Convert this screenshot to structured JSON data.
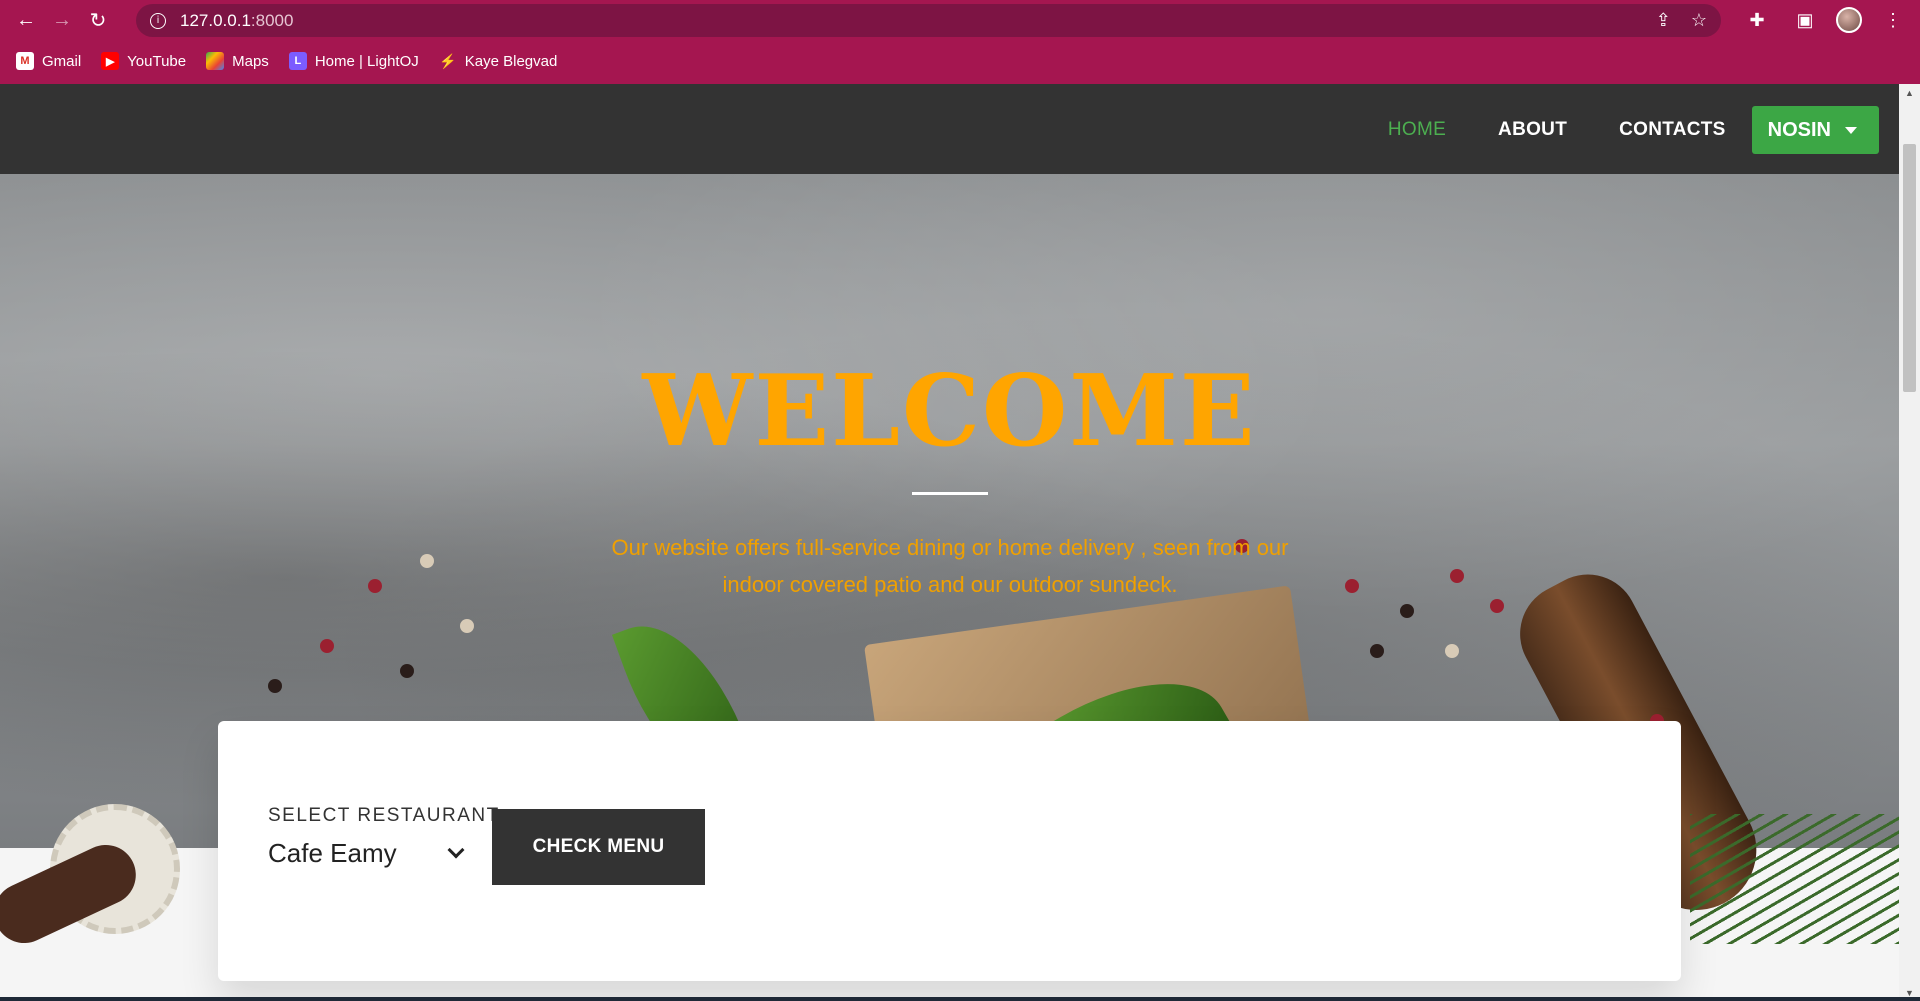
{
  "browser": {
    "url_host": "127.0.0.1",
    "url_port": ":8000",
    "bookmarks": [
      {
        "label": "Gmail",
        "icon": "gmail-icon"
      },
      {
        "label": "YouTube",
        "icon": "youtube-icon"
      },
      {
        "label": "Maps",
        "icon": "maps-icon"
      },
      {
        "label": "Home | LightOJ",
        "icon": "lightoj-icon"
      },
      {
        "label": "Kaye Blegvad",
        "icon": "bolt-icon"
      }
    ]
  },
  "nav": {
    "links": [
      "HOME",
      "ABOUT",
      "CONTACTS"
    ],
    "active": "HOME",
    "user_button": "NOSIN"
  },
  "hero": {
    "title": "WELCOME",
    "text": "Our website offers full-service dining or home delivery , seen from our indoor covered patio and our outdoor sundeck."
  },
  "search": {
    "label": "SELECT RESTAURANT",
    "selected": "Cafe Eamy",
    "button": "CHECK MENU"
  },
  "colors": {
    "browser_frame": "#a51650",
    "navbar": "#333333",
    "accent_green": "#3ca745",
    "hero_title": "#ffa500"
  }
}
